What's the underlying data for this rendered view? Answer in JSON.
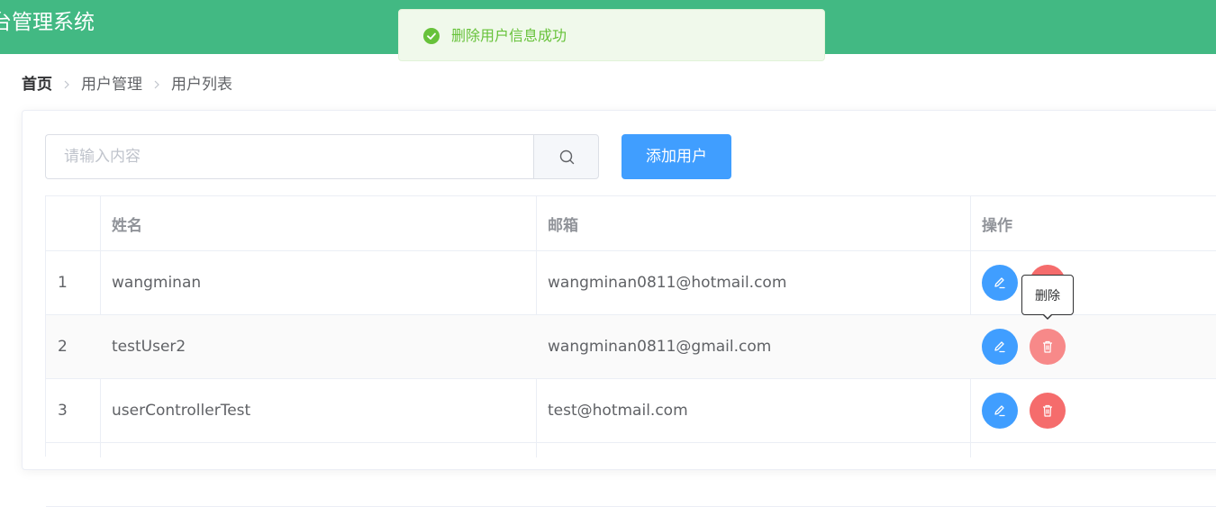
{
  "header": {
    "title": "台管理系统",
    "bg_color": "#42b983"
  },
  "toast": {
    "message": "删除用户信息成功",
    "type": "success",
    "icon": "check-circle-icon",
    "color": "#67c23a"
  },
  "breadcrumb": {
    "home": "首页",
    "items": [
      "用户管理",
      "用户列表"
    ]
  },
  "toolbar": {
    "search_placeholder": "请输入内容",
    "search_value": "",
    "search_icon": "search-icon",
    "add_label": "添加用户",
    "accent_color": "#409eff"
  },
  "table": {
    "columns": [
      "",
      "姓名",
      "邮箱",
      "操作"
    ],
    "rows": [
      {
        "index": "1",
        "name": "wangminan",
        "email": "wangminan0811@hotmail.com"
      },
      {
        "index": "2",
        "name": "testUser2",
        "email": "wangminan0811@gmail.com"
      },
      {
        "index": "3",
        "name": "userControllerTest",
        "email": "test@hotmail.com"
      }
    ],
    "edit_icon": "pencil-icon",
    "delete_icon": "trash-icon",
    "delete_color": "#f56c6c"
  },
  "tooltip": {
    "text": "删除"
  }
}
